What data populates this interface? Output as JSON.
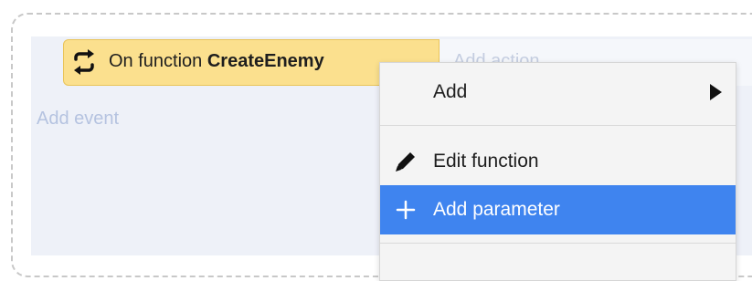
{
  "event": {
    "icon": "repeat-arrows-icon",
    "prefix": "On function ",
    "function_name": "CreateEnemy"
  },
  "action_placeholder": "Add action",
  "add_event": "Add event",
  "context_menu": {
    "add": {
      "label": "Add",
      "icon": "submenu-arrow-icon"
    },
    "edit_function": {
      "label": "Edit function",
      "icon": "pencil-icon"
    },
    "add_parameter": {
      "label": "Add parameter",
      "icon": "plus-icon",
      "highlighted": true
    }
  },
  "colors": {
    "event_block": "#fbe08e",
    "highlight": "#3f84ef",
    "hint_text": "#b5c3e0"
  }
}
